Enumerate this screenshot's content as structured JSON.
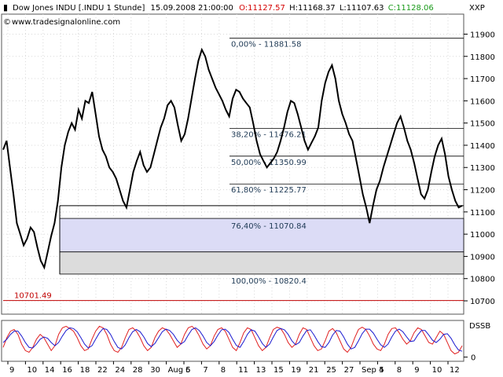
{
  "header": {
    "symbol": "Dow Jones INDU [.INDU  1 Stunde]",
    "datetime": "15.09.2008 21:00:00",
    "open": "O:11127.57",
    "high": "H:11168.37",
    "low": "L:11107.63",
    "close": "C:11128.06",
    "right_label": "XXP",
    "site": "www.tradesignalonline.com"
  },
  "colors": {
    "open": "#d40000",
    "close": "#1a9a1a",
    "price_line": "#000000",
    "stoch_k": "#1a1ad0",
    "stoch_d": "#e02020",
    "support_line": "#c00000",
    "fib_fill_top": "#dcdcf6",
    "fib_fill_bottom": "#dcdcdc"
  },
  "chart_data": [
    {
      "type": "line",
      "ylim": [
        10640,
        11990
      ],
      "yticks": [
        10700,
        10800,
        10900,
        11000,
        11100,
        11200,
        11300,
        11400,
        11500,
        11600,
        11700,
        11800,
        11900
      ],
      "x_tick_labels": [
        "9",
        "10",
        "14",
        "16",
        "18",
        "22",
        "24",
        "28",
        "30",
        "Aug 5",
        "6",
        "7",
        "8",
        "11",
        "13",
        "15",
        "19",
        "21",
        "25",
        "27",
        "Sep 4",
        "5",
        "8",
        "9",
        "10",
        "12"
      ],
      "series": [
        {
          "values": [
            11380,
            11420,
            11300,
            11180,
            11050,
            11000,
            10950,
            10980,
            11030,
            11010,
            10940,
            10880,
            10850,
            10920,
            10990,
            11050,
            11150,
            11300,
            11400,
            11460,
            11500,
            11470,
            11560,
            11520,
            11600,
            11590,
            11640,
            11540,
            11440,
            11380,
            11350,
            11300,
            11280,
            11250,
            11200,
            11150,
            11120,
            11200,
            11280,
            11330,
            11370,
            11310,
            11280,
            11300,
            11360,
            11420,
            11480,
            11520,
            11580,
            11600,
            11570,
            11490,
            11420,
            11450,
            11520,
            11610,
            11700,
            11780,
            11830,
            11800,
            11740,
            11700,
            11660,
            11630,
            11600,
            11560,
            11530,
            11610,
            11650,
            11640,
            11610,
            11590,
            11570,
            11500,
            11420,
            11360,
            11330,
            11300,
            11320,
            11340,
            11370,
            11420,
            11480,
            11550,
            11600,
            11590,
            11540,
            11480,
            11420,
            11380,
            11410,
            11440,
            11480,
            11600,
            11680,
            11730,
            11760,
            11700,
            11600,
            11540,
            11500,
            11450,
            11420,
            11340,
            11260,
            11180,
            11120,
            11050,
            11130,
            11200,
            11240,
            11300,
            11350,
            11400,
            11450,
            11500,
            11530,
            11480,
            11420,
            11380,
            11320,
            11250,
            11180,
            11160,
            11200,
            11280,
            11350,
            11400,
            11430,
            11360,
            11260,
            11200,
            11150,
            11120,
            11128
          ]
        }
      ],
      "fib_levels": [
        {
          "label": "0,00% - 11881.58",
          "value": 11881.58
        },
        {
          "label": "38,20% - 11476.21",
          "value": 11476.21
        },
        {
          "label": "50,00% - 11350.99",
          "value": 11350.99
        },
        {
          "label": "61,80% - 11225.77",
          "value": 11225.77
        },
        {
          "label": "76,40% - 11070.84",
          "value": 11070.84
        },
        {
          "label": "100,00% - 10820.4",
          "value": 10820.4
        }
      ],
      "extra_hlines": [
        11128.06,
        10920
      ],
      "support": {
        "label": "10701.49",
        "value": 10701.49
      },
      "grid": true
    },
    {
      "type": "line",
      "title": "DSSB",
      "ylim": [
        -8,
        108
      ],
      "yticks": [
        0
      ],
      "series": [
        {
          "values": [
            30,
            60,
            80,
            85,
            70,
            40,
            20,
            15,
            30,
            55,
            70,
            60,
            40,
            20,
            35,
            70,
            90,
            95,
            88,
            80,
            60,
            35,
            20,
            25,
            55,
            80,
            95,
            90,
            70,
            40,
            20,
            15,
            30,
            60,
            85,
            90,
            80,
            60,
            35,
            20,
            30,
            60,
            80,
            90,
            85,
            70,
            50,
            30,
            40,
            70,
            90,
            95,
            85,
            65,
            40,
            25,
            35,
            65,
            85,
            90,
            80,
            55,
            30,
            20,
            45,
            75,
            90,
            85,
            60,
            35,
            20,
            30,
            60,
            85,
            92,
            88,
            70,
            45,
            30,
            40,
            70,
            90,
            85,
            60,
            35,
            20,
            25,
            50,
            80,
            88,
            75,
            50,
            25,
            15,
            30,
            60,
            85,
            92,
            85,
            65,
            40,
            25,
            20,
            40,
            70,
            88,
            90,
            75,
            55,
            40,
            50,
            75,
            90,
            85,
            65,
            45,
            40,
            60,
            80,
            70,
            45,
            20,
            10,
            15,
            35
          ]
        },
        {
          "values": [
            45,
            55,
            70,
            80,
            80,
            65,
            45,
            30,
            28,
            40,
            55,
            62,
            58,
            45,
            35,
            45,
            65,
            82,
            90,
            88,
            78,
            60,
            40,
            28,
            35,
            55,
            75,
            88,
            85,
            70,
            48,
            30,
            25,
            38,
            60,
            78,
            85,
            78,
            62,
            42,
            32,
            42,
            60,
            78,
            86,
            82,
            70,
            52,
            40,
            48,
            68,
            85,
            90,
            82,
            65,
            45,
            35,
            48,
            68,
            84,
            86,
            76,
            55,
            36,
            30,
            48,
            70,
            84,
            80,
            62,
            42,
            30,
            40,
            62,
            82,
            88,
            84,
            70,
            50,
            38,
            45,
            65,
            82,
            84,
            68,
            48,
            32,
            30,
            45,
            68,
            82,
            80,
            62,
            40,
            25,
            30,
            50,
            72,
            86,
            86,
            74,
            55,
            38,
            30,
            40,
            62,
            80,
            86,
            78,
            62,
            48,
            50,
            68,
            82,
            82,
            68,
            52,
            45,
            55,
            70,
            72,
            58,
            38,
            22,
            18
          ]
        }
      ]
    }
  ]
}
